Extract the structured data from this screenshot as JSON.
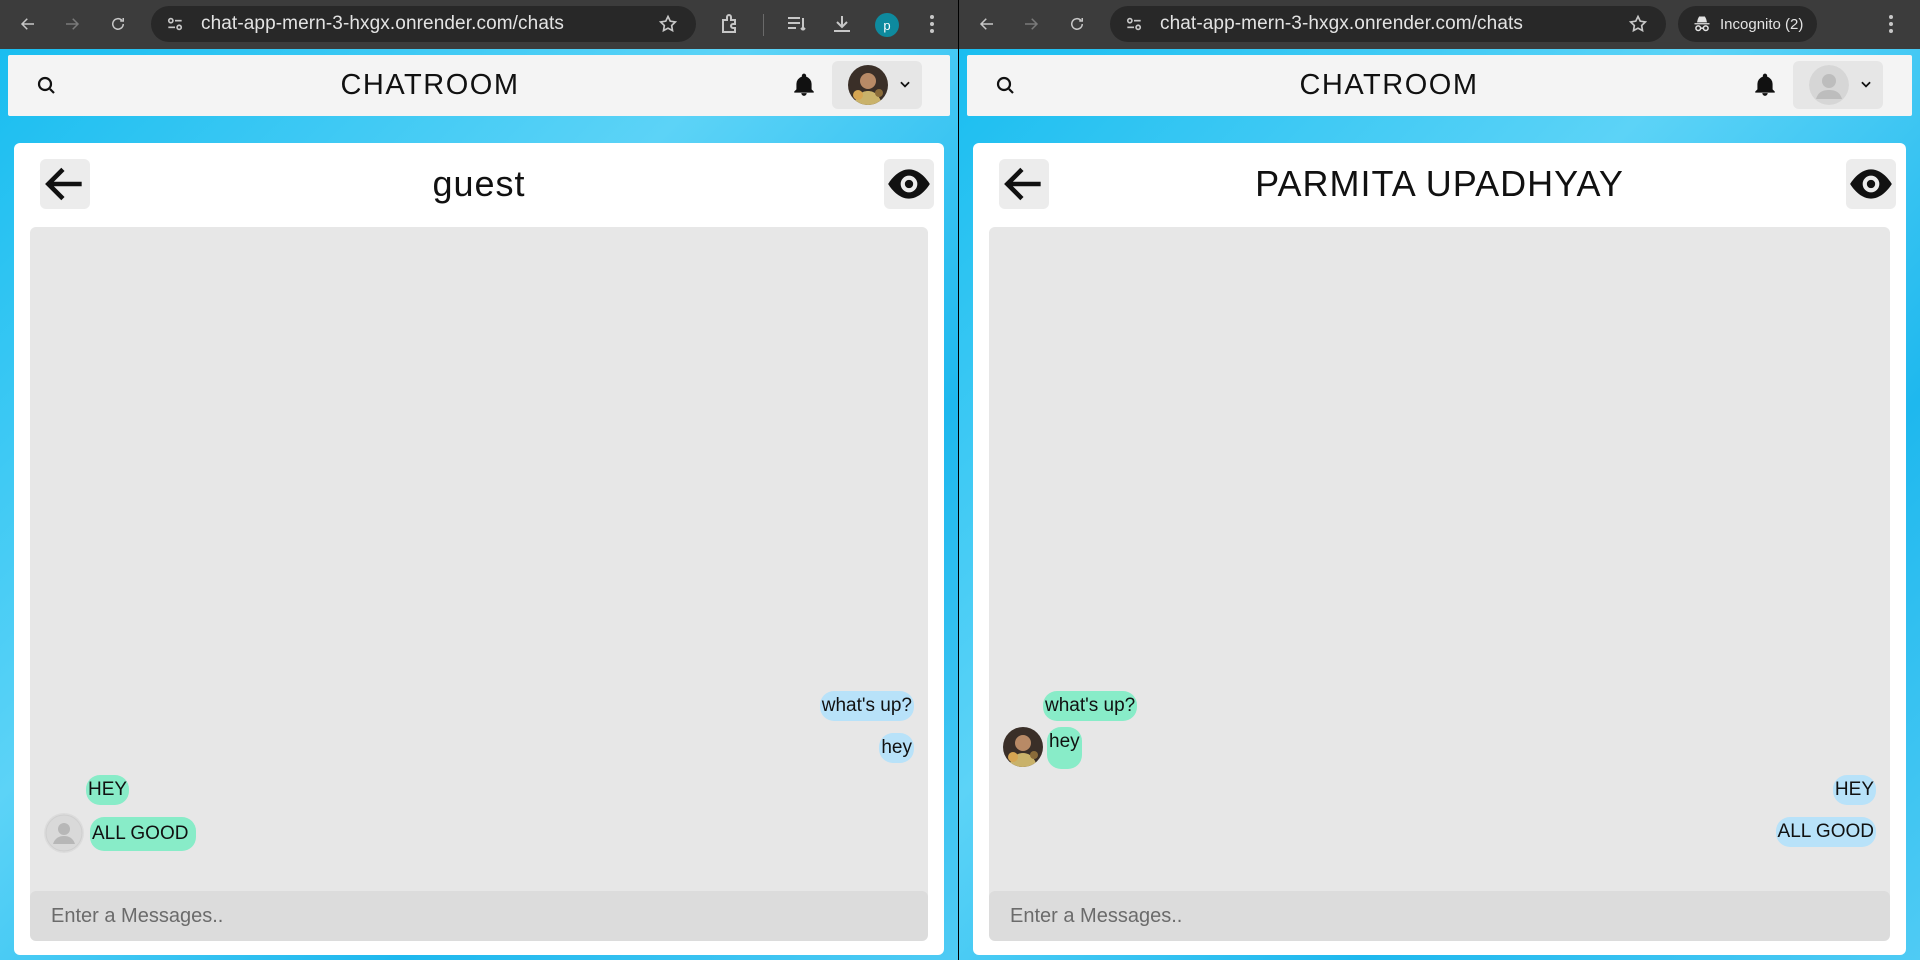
{
  "left_window": {
    "url": "chat-app-mern-3-hxgx.onrender.com/chats",
    "profile_initial": "p",
    "app_title": "CHATROOM",
    "chat_title": "guest",
    "input_placeholder": "Enter a Messages..",
    "messages": [
      {
        "text": "what's up?",
        "side": "right",
        "color": "blue"
      },
      {
        "text": "hey",
        "side": "right",
        "color": "blue"
      },
      {
        "text": "HEY",
        "side": "left",
        "color": "green"
      },
      {
        "text": "ALL GOOD",
        "side": "left",
        "color": "green",
        "avatar": "default-user-icon"
      }
    ]
  },
  "right_window": {
    "url": "chat-app-mern-3-hxgx.onrender.com/chats",
    "incognito_label": "Incognito (2)",
    "app_title": "CHATROOM",
    "chat_title": "PARMITA UPADHYAY",
    "input_placeholder": "Enter a Messages..",
    "messages": [
      {
        "text": "what's up?",
        "side": "left",
        "color": "green"
      },
      {
        "text": "hey",
        "side": "left",
        "color": "green",
        "avatar": "photo"
      },
      {
        "text": "HEY",
        "side": "right",
        "color": "blue"
      },
      {
        "text": "ALL GOOD",
        "side": "right",
        "color": "blue"
      }
    ]
  },
  "colors": {
    "sent_bubble": "#b8e2f9",
    "received_bubble": "#88ecc8",
    "chat_background": "#e7e7e7",
    "page_accent": "#19bdf0"
  }
}
